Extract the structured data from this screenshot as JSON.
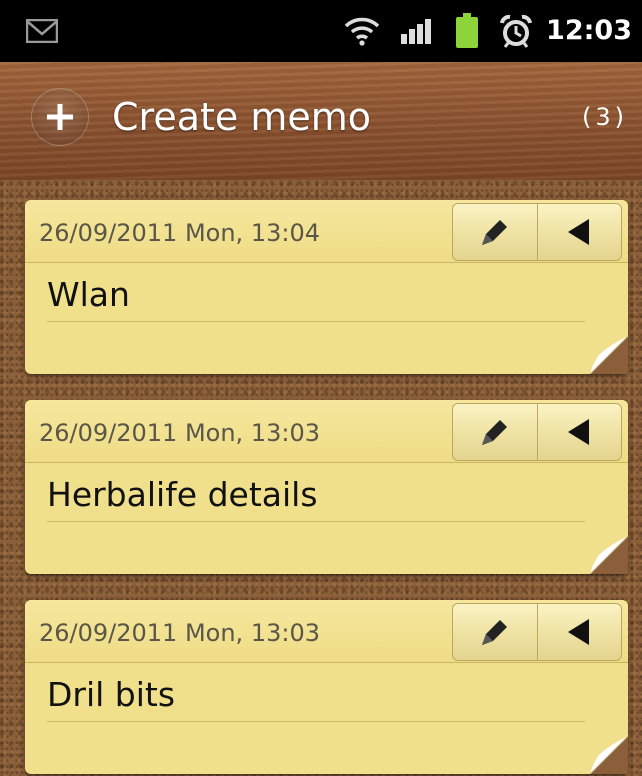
{
  "status_bar": {
    "time": "12:03",
    "icons": [
      "gmail-icon",
      "wifi-icon",
      "signal-icon",
      "battery-icon",
      "alarm-icon"
    ]
  },
  "header": {
    "add_icon": "plus-icon",
    "title": "Create memo",
    "count": "(3)"
  },
  "memos": [
    {
      "date": "26/09/2011 Mon, 13:04",
      "text": "Wlan"
    },
    {
      "date": "26/09/2011 Mon, 13:03",
      "text": "Herbalife details"
    },
    {
      "date": "26/09/2011 Mon, 13:03",
      "text": "Dril bits"
    }
  ],
  "colors": {
    "memo_background": "#f1e08b",
    "header_wood": "#8e5430",
    "cork": "#8a5f3a",
    "battery": "#8cd43a"
  }
}
